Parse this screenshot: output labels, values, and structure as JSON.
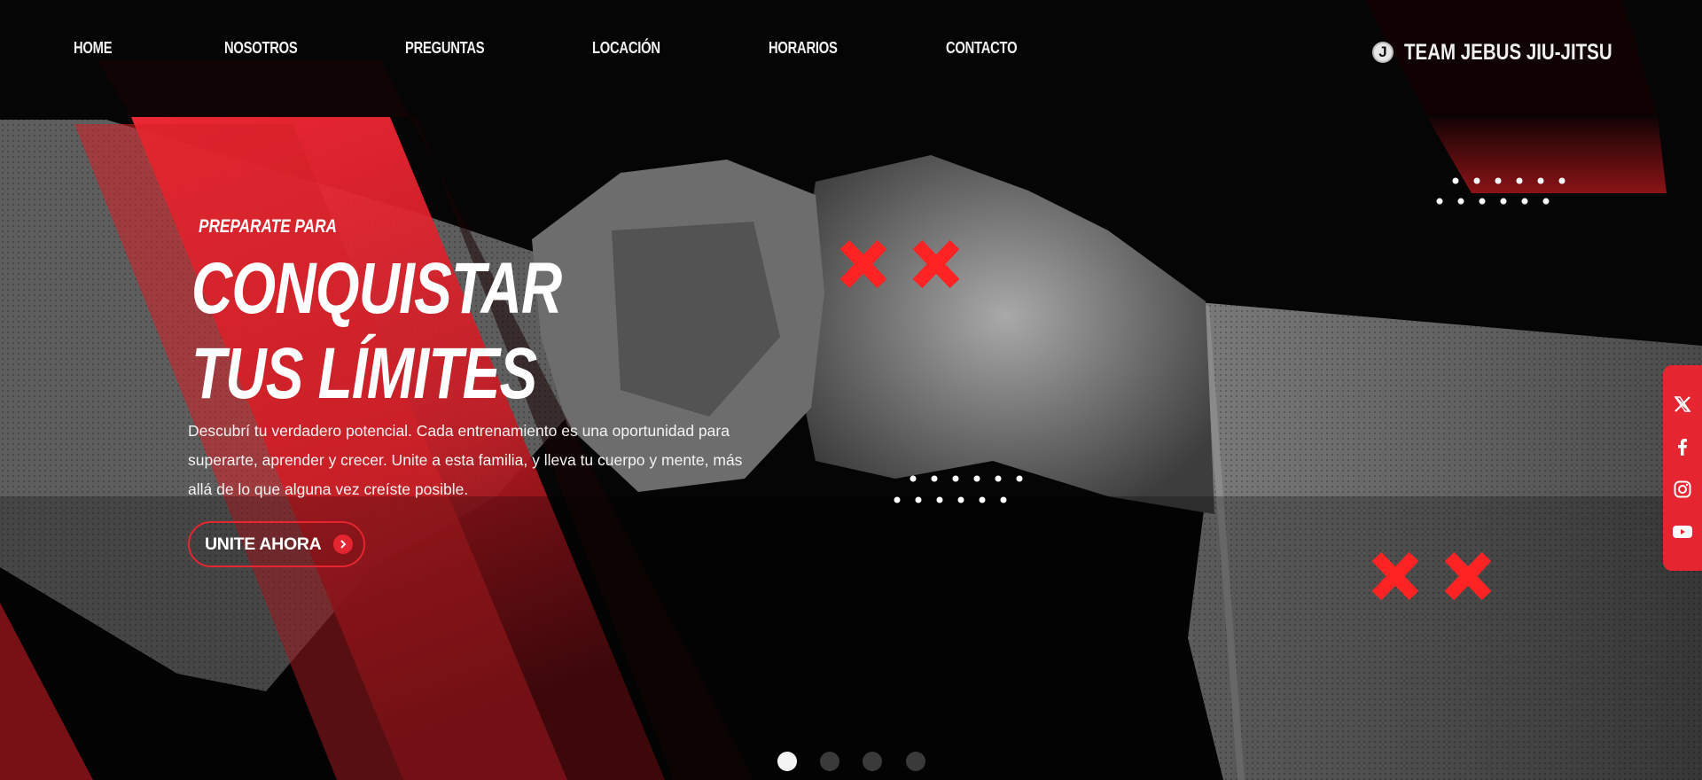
{
  "nav": {
    "items": [
      "HOME",
      "NOSOTROS",
      "PREGUNTAS",
      "LOCACIÓN",
      "HORARIOS",
      "CONTACTO"
    ]
  },
  "brand": {
    "logo_letter": "J",
    "name": "TEAM JEBUS JIU-JITSU"
  },
  "hero": {
    "kicker": "PREPARATE PARA",
    "headline_line1": "CONQUISTAR",
    "headline_line2": "TUS LÍMITES",
    "description": "Descubrí tu verdadero potencial. Cada entrenamiento es una oportunidad para superarte, aprender y crecer. Unite a esta familia, y lleva tu cuerpo y mente, más allá de lo que alguna vez creíste posible.",
    "cta_label": "UNITE AHORA",
    "cta_icon": "arrow-right-circle-icon"
  },
  "social": {
    "icons": [
      "x-icon",
      "facebook-icon",
      "instagram-icon",
      "youtube-icon"
    ]
  },
  "slider": {
    "total_slides": 4,
    "active_slide": 1
  },
  "colors": {
    "accent": "#e52530",
    "background": "#050505"
  }
}
